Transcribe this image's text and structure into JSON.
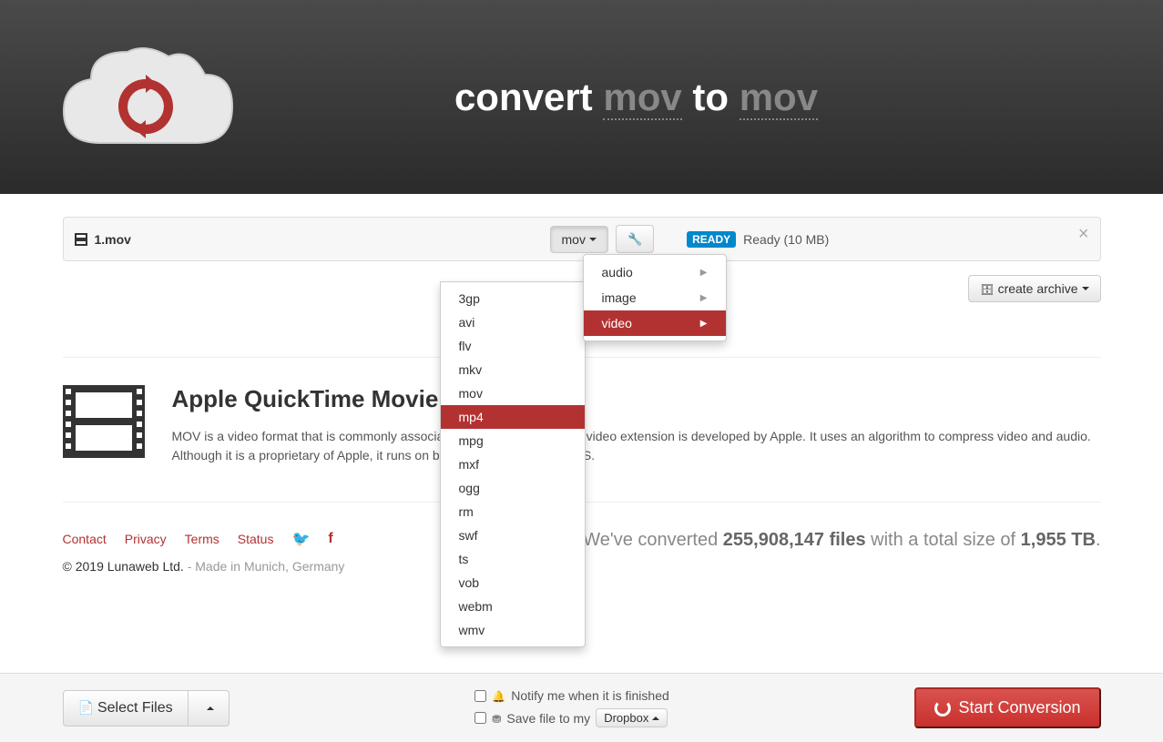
{
  "header": {
    "title_prefix": "convert ",
    "title_from": "mov",
    "title_mid": " to ",
    "title_to": "mov"
  },
  "file": {
    "name": "1.mov",
    "format_selected": "mov",
    "status_badge": "READY",
    "status_text": "Ready (10 MB)"
  },
  "archive_button": "create archive",
  "dropdown_categories": [
    {
      "label": "audio",
      "active": false
    },
    {
      "label": "image",
      "active": false
    },
    {
      "label": "video",
      "active": true
    }
  ],
  "dropdown_formats": [
    "3gp",
    "avi",
    "flv",
    "mkv",
    "mov",
    "mp4",
    "mpg",
    "mxf",
    "ogg",
    "rm",
    "swf",
    "ts",
    "vob",
    "webm",
    "wmv"
  ],
  "dropdown_format_active": "mp4",
  "info": {
    "title": "Apple QuickTime Movie",
    "text": "MOV is a video format that is commonly associated with QuickTime. This video extension is developed by Apple. It uses an algorithm to compress video and audio. Although it is a proprietary of Apple, it runs on both MAC and Windows OS."
  },
  "footer": {
    "links": [
      "Contact",
      "Privacy",
      "Terms",
      "Status"
    ],
    "copyright": "© 2019 Lunaweb Ltd.",
    "made_in": " - Made in Munich, Germany"
  },
  "stats": {
    "prefix": "We've converted ",
    "files": "255,908,147 files",
    "mid": " with a total size of ",
    "size": "1,955 TB",
    "suffix": "."
  },
  "bottom": {
    "select_files": "Select Files",
    "notify": "Notify me when it is finished",
    "save_to": "Save file to my",
    "dropbox": "Dropbox",
    "start": "Start Conversion"
  }
}
